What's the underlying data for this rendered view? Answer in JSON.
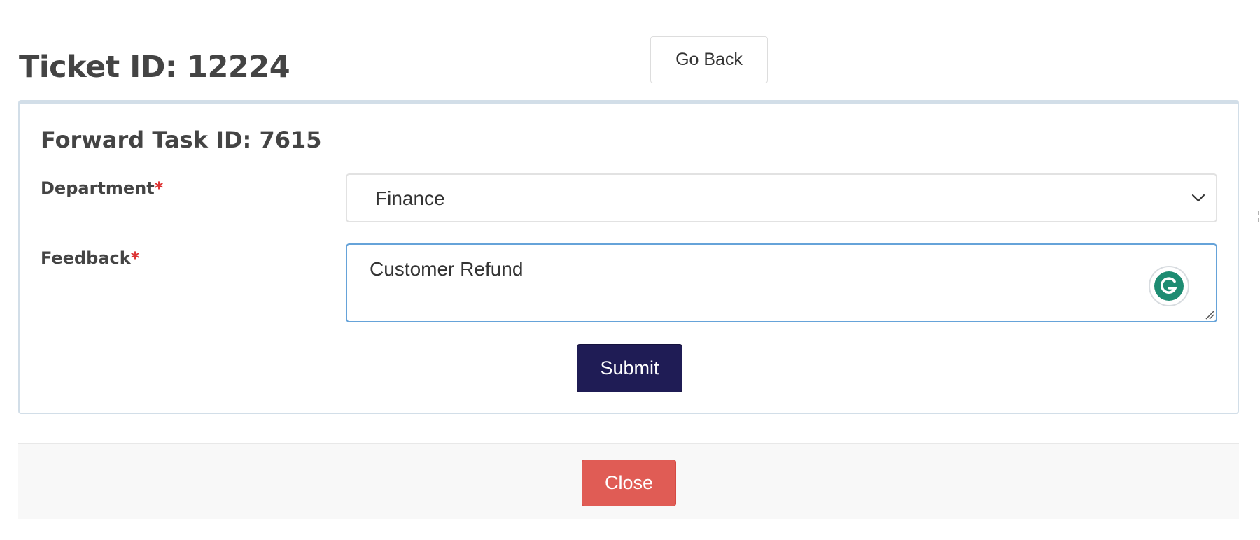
{
  "header": {
    "title": "Ticket ID: 12224",
    "go_back_label": "Go Back"
  },
  "form": {
    "title": "Forward Task ID: 7615",
    "department": {
      "label": "Department",
      "required_mark": "*",
      "selected_value": "Finance",
      "icon": "chevron-down-icon"
    },
    "feedback": {
      "label": "Feedback",
      "required_mark": "*",
      "value": "Customer Refund",
      "assistant_icon": "grammarly-icon"
    },
    "submit_label": "Submit"
  },
  "footer": {
    "close_label": "Close"
  },
  "colors": {
    "submit_bg": "#1f1c55",
    "close_bg": "#e05c55",
    "required_mark": "#dd3333",
    "focus_border": "#66a3d9",
    "panel_border": "#d2dee8",
    "grammarly_green": "#15a07e"
  }
}
